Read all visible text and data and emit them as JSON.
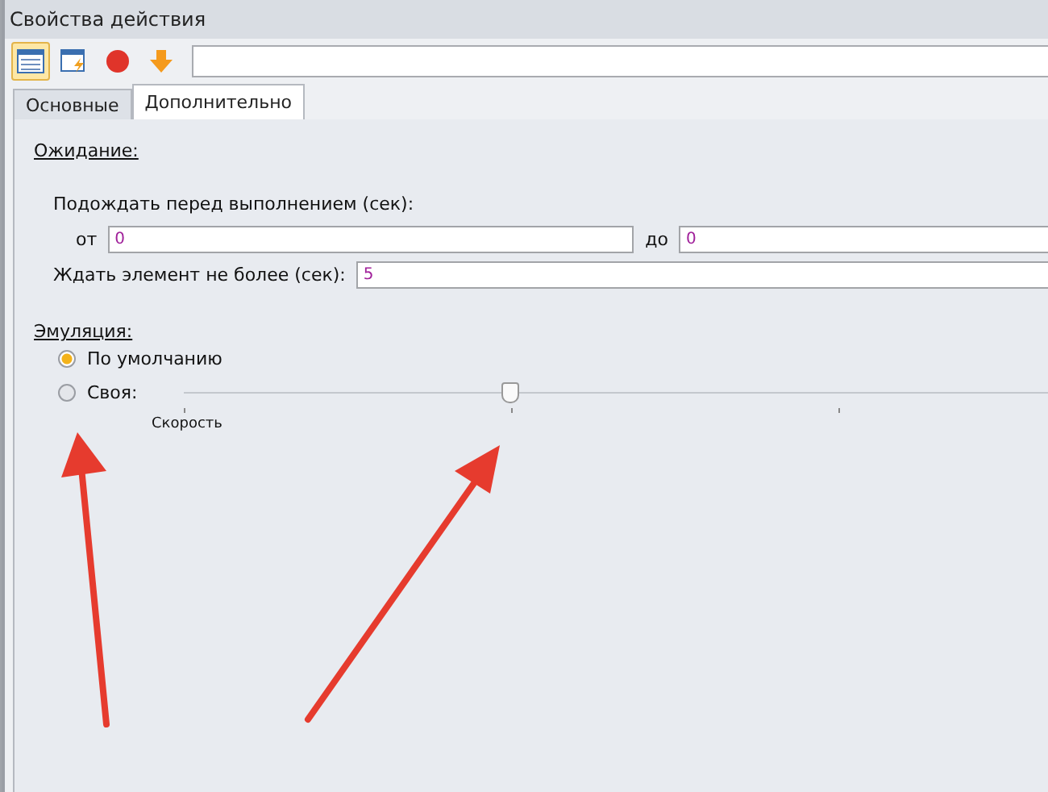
{
  "window": {
    "title": "Свойства действия"
  },
  "toolbar": {
    "buttons": [
      {
        "kind": "table",
        "selected": true
      },
      {
        "kind": "form",
        "selected": false
      },
      {
        "kind": "stop",
        "selected": false
      },
      {
        "kind": "down",
        "selected": false
      }
    ]
  },
  "tabs": [
    {
      "label": "Основные",
      "selected": false
    },
    {
      "label": "Дополнительно",
      "selected": true
    }
  ],
  "waiting": {
    "heading": "Ожидание:",
    "delay_label": "Подождать перед выполнением (сек):",
    "from_label": "от",
    "from_value": "0",
    "to_label": "до",
    "to_value": "0",
    "timeout_label": "Ждать элемент не более (сек):",
    "timeout_value": "5"
  },
  "emulation": {
    "heading": "Эмуляция:",
    "options": [
      {
        "label": "По умолчанию",
        "selected": true
      },
      {
        "label": "Своя:",
        "selected": false
      }
    ],
    "slider": {
      "level": 0.25,
      "label": "Скорость"
    }
  }
}
